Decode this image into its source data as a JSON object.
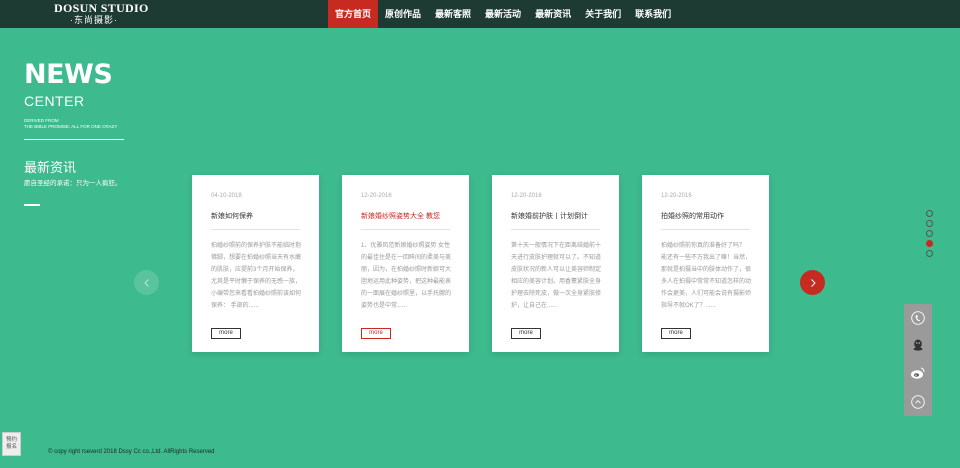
{
  "header": {
    "logo_en": "DOSUN STUDIO",
    "logo_cn": "·东尚摄影·",
    "nav": [
      {
        "label": "官方首页"
      },
      {
        "label": "原创作品"
      },
      {
        "label": "最新客照"
      },
      {
        "label": "最新活动"
      },
      {
        "label": "最新资讯"
      },
      {
        "label": "关于我们"
      },
      {
        "label": "联系我们"
      }
    ]
  },
  "hero": {
    "news": "NEWS",
    "center": "CENTER",
    "derived_line1": "DERIVED FROM",
    "derived_line2": "THE BIBLE PROMISE: ALL FOR ONE CRAZY",
    "section_title": "最新资讯",
    "section_sub": "愿自圣经的承诺：只为一人疯狂。"
  },
  "cards": [
    {
      "date": "04-10-2018",
      "title": "新娘如何保养",
      "excerpt": "拍婚纱照前的保养护肤不能临时抱佛脚，想要在拍婚纱照当天有水嫩的肌肤，应提前3个月开始保养，尤其是平时懒于保养的无感一族，小编带您来看看拍婚纱照前该如何保养： 手部的......",
      "more": "more"
    },
    {
      "date": "12-20-2016",
      "title": "新娘婚纱照姿势大全 教您",
      "excerpt": "1、优雅风范新娘婚纱照姿势 女性的最佳住是在一回眸间的柔美与美丽，因为，在拍婚纱照时新娘可大胆地运用此种姿势，把这种最能表的一面展在婚纱照里，以手托腮的姿势也是中常......",
      "more": "more"
    },
    {
      "date": "12-20-2016",
      "title": "新娘婚前护肤丨计划倒计",
      "excerpt": "第十天一般情况下在距离结婚前十天进行皮肤护理就可以了。不知道皮肤状况的新人可以让美容师制定相应的美容计划。用香薰紧肤全身护理去除死皮，做一次全身紧肤修护，让自己在......",
      "more": "more"
    },
    {
      "date": "12-20-2016",
      "title": "拍婚纱照的常用动作",
      "excerpt": "拍婚纱照前你真的准备好了吗？ 能还有一些不万我出了嘛！当然，那就是拍摄当中的肢体动作了，很多人在拍摄中常常不知道怎样的动作会更美，人们可能会说有摄影师指导不就OK了？......",
      "more": "more"
    }
  ],
  "footer": {
    "copyright": "© copy right rseverd 2018 Dssy Cc co.,Ltd. AllRights Reserved"
  },
  "appointment": {
    "line1": "预约",
    "line2": "报名"
  },
  "colors": {
    "background": "#3dba8e",
    "topbar": "#1d3b33",
    "accent": "#c62a21"
  },
  "icons": {
    "sidebar": [
      "phone-icon",
      "qq-icon",
      "weibo-icon",
      "back-to-top-icon"
    ],
    "arrows": [
      "chevron-left-icon",
      "chevron-right-icon"
    ]
  }
}
